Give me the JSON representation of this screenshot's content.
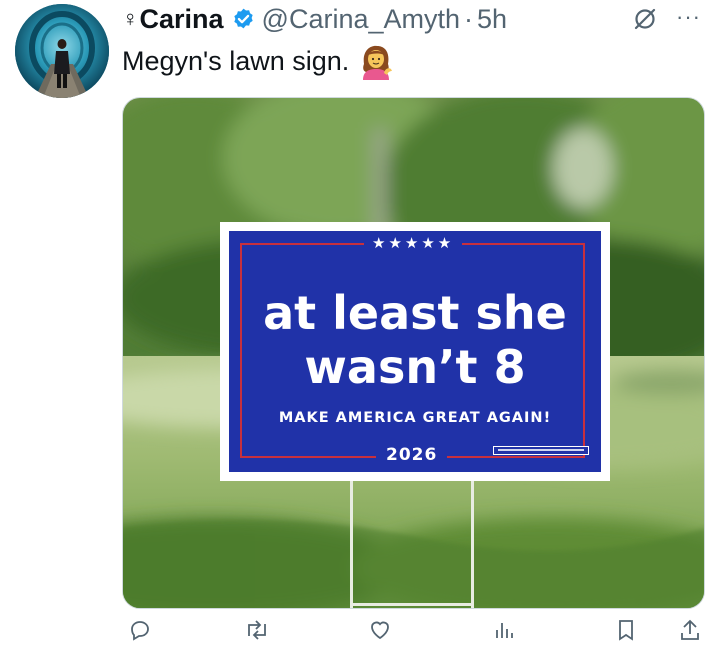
{
  "tweet": {
    "author": {
      "symbol": "♀",
      "display_name": "Carina",
      "handle": "@Carina_Amyth",
      "separator": "·",
      "timestamp": "5h",
      "verified_color": "#1d9bf0"
    },
    "text": "Megyn's lawn sign.",
    "emoji_icon": "person-tipping-hand-emoji",
    "more_icon": "···",
    "media": {
      "type": "photo",
      "sign": {
        "stars": "★★★★★",
        "headline": "at least she\nwasn’t 8",
        "slogan": "MAKE AMERICA GREAT AGAIN!",
        "year": "2026",
        "colors": {
          "field": "#2032a8",
          "border": "#c8303d",
          "text": "#ffffff"
        }
      }
    },
    "actions": [
      {
        "name": "reply-icon"
      },
      {
        "name": "retweet-icon"
      },
      {
        "name": "like-icon"
      },
      {
        "name": "views-icon"
      },
      {
        "name": "bookmark-icon"
      },
      {
        "name": "share-icon"
      }
    ]
  }
}
